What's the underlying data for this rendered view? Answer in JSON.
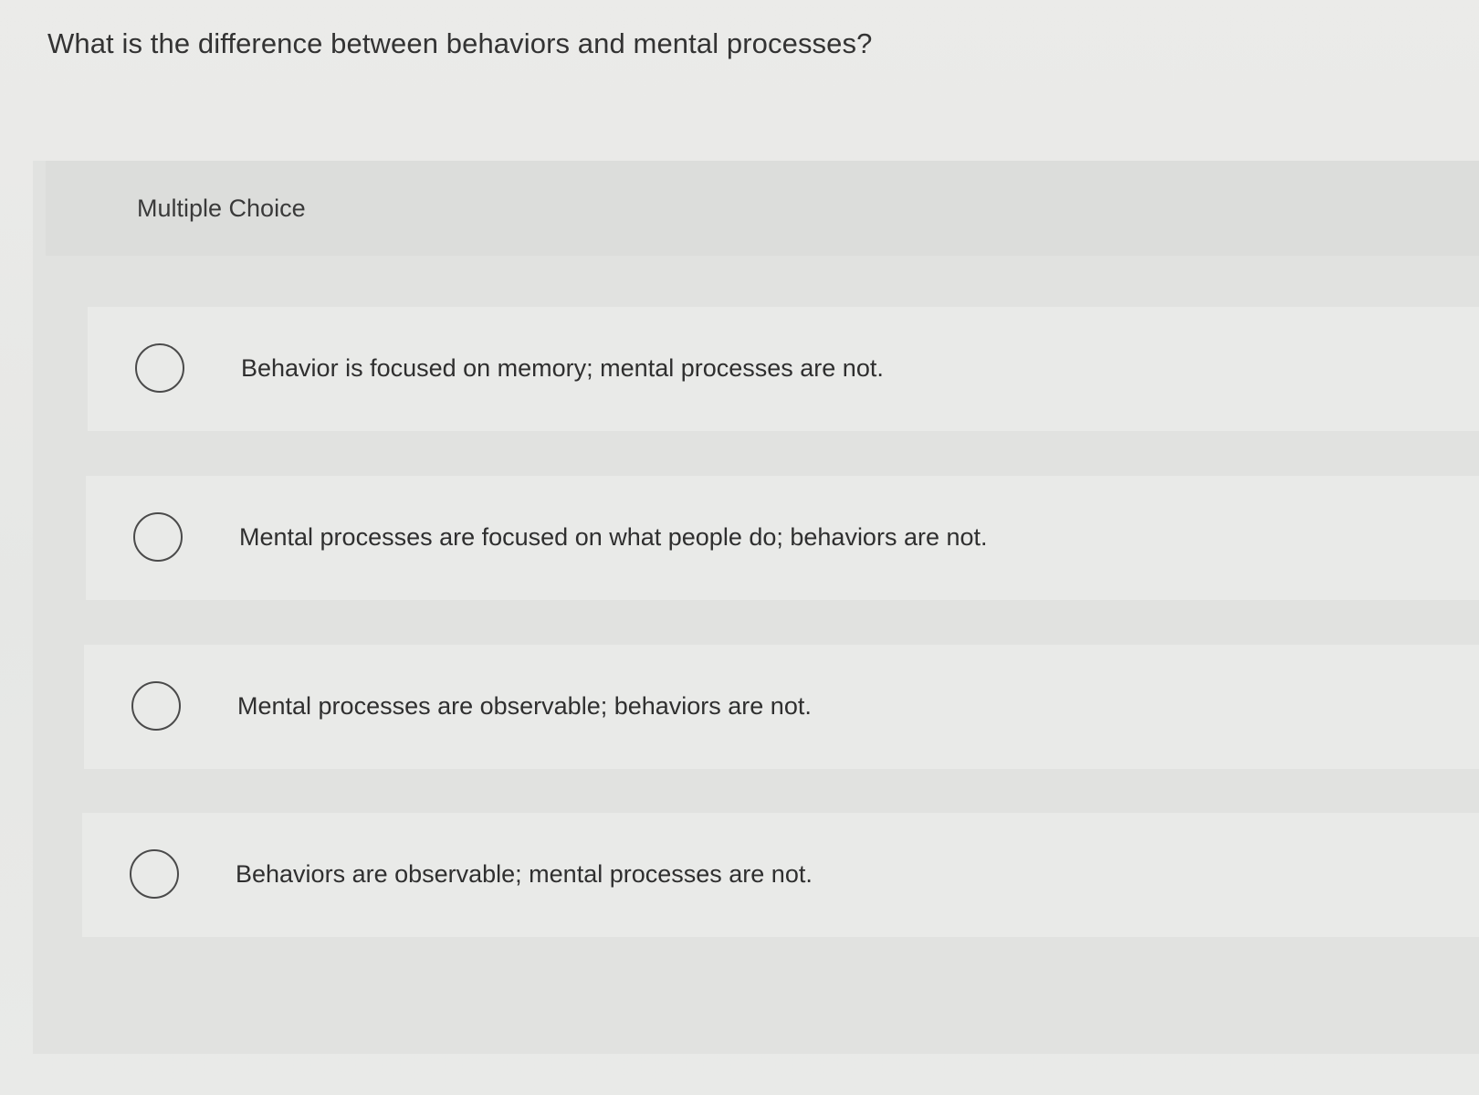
{
  "question": {
    "text": "What is the difference between behaviors and mental processes?"
  },
  "panel": {
    "header_label": "Multiple Choice"
  },
  "options": [
    {
      "label": "Behavior is focused on memory; mental processes are not.",
      "selected": false
    },
    {
      "label": "Mental processes are focused on what people do; behaviors are not.",
      "selected": false
    },
    {
      "label": "Mental processes are observable; behaviors are not.",
      "selected": false
    },
    {
      "label": "Behaviors are observable; mental processes are not.",
      "selected": false
    }
  ],
  "colors": {
    "background": "#e8e9e7",
    "panel": "#e1e2e0",
    "option_row": "#e9eae8",
    "radio_border": "#4a4a4a",
    "text": "#2f2f2f"
  },
  "icons": {
    "radio": "radio-circle-icon"
  }
}
